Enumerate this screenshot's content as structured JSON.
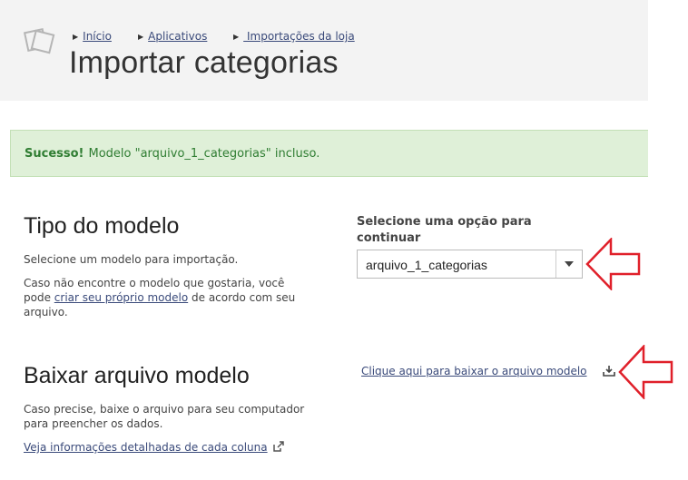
{
  "breadcrumb": {
    "items": [
      {
        "label": "Início"
      },
      {
        "label": "Aplicativos"
      },
      {
        "label": " Importações da loja"
      }
    ]
  },
  "page": {
    "title": "Importar categorias"
  },
  "alert": {
    "strong": "Sucesso!",
    "message": "Modelo \"arquivo_1_categorias\" incluso.",
    "color": "#dff0d8"
  },
  "model_type": {
    "title": "Tipo do modelo",
    "description": "Selecione um modelo para importação.",
    "help_prefix": "Caso não encontre o modelo que gostaria, você pode ",
    "help_link": "criar seu próprio modelo",
    "help_suffix": " de acordo com seu arquivo.",
    "select_label": "Selecione uma opção para continuar",
    "select_value": "arquivo_1_categorias"
  },
  "download": {
    "title": "Baixar arquivo modelo",
    "description": "Caso precise, baixe o arquivo para seu computador para preencher os dados.",
    "details_link": "Veja informações detalhadas de cada coluna",
    "download_link": "Clique aqui para baixar o arquivo modelo"
  },
  "icons": {
    "page": "pages-icon",
    "download": "download-icon",
    "external": "external-link-icon"
  },
  "colors": {
    "accent_link": "#3a4a7a",
    "annotation_arrow": "#e0202a"
  }
}
